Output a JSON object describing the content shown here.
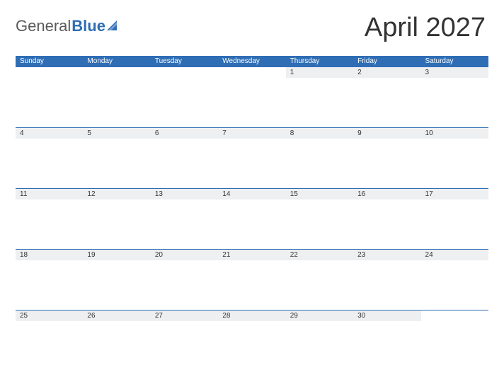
{
  "brand": {
    "part1": "General",
    "part2": "Blue"
  },
  "title": "April 2027",
  "colors": {
    "accent": "#2f6eb5",
    "headerRow": "#eeeff1"
  },
  "days": [
    "Sunday",
    "Monday",
    "Tuesday",
    "Wednesday",
    "Thursday",
    "Friday",
    "Saturday"
  ],
  "weeks": [
    [
      "",
      "",
      "",
      "",
      "1",
      "2",
      "3"
    ],
    [
      "4",
      "5",
      "6",
      "7",
      "8",
      "9",
      "10"
    ],
    [
      "11",
      "12",
      "13",
      "14",
      "15",
      "16",
      "17"
    ],
    [
      "18",
      "19",
      "20",
      "21",
      "22",
      "23",
      "24"
    ],
    [
      "25",
      "26",
      "27",
      "28",
      "29",
      "30",
      ""
    ]
  ]
}
